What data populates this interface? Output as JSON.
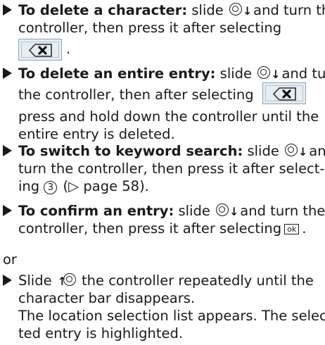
{
  "steps": [
    {
      "lead": "To delete a character:",
      "t1": " slide ",
      "t2": " and turn the",
      "line2": "controller, then press it after selecting",
      "after_button": "."
    },
    {
      "lead": "To delete an entire entry:",
      "t1": " slide ",
      "t2": " and turn",
      "line2": "the controller, then after selecting",
      "line3": "press and hold down the controller until the",
      "line4": "entire entry is deleted."
    },
    {
      "lead": "To switch to keyword search:",
      "t1": " slide ",
      "t2": " and",
      "line2": "turn the controller, then press it after select-",
      "line3_a": "ing ",
      "circled_number": "3",
      "line3_b": " (▷ page 58)."
    },
    {
      "lead": "To confirm an entry:",
      "t1": " slide ",
      "t2": " and turn the",
      "line2_a": "controller, then press it after selecting",
      "ok_label": "ok",
      "line2_b": "."
    }
  ],
  "or_text": "or",
  "final_step": {
    "line1_a": "Slide ",
    "line1_b": " the controller repeatedly until the",
    "line2": "character bar disappears.",
    "line3": "The location selection list appears. The selec-",
    "line4": "ted entry is highlighted."
  },
  "icons": {
    "slide_down": "controller-slide-down-icon",
    "slide_up": "controller-slide-up-icon",
    "delete": "backspace-delete-icon"
  }
}
